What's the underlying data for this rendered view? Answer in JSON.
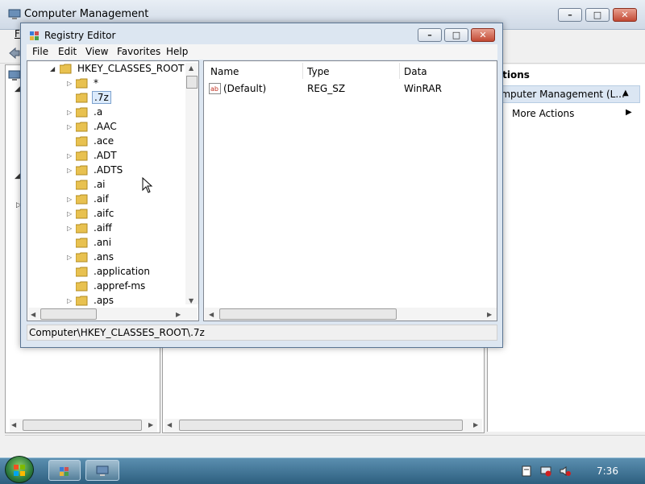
{
  "computer_management": {
    "title": "Computer Management",
    "menu_file": "F",
    "actions": {
      "header": "ctions",
      "selected_item": "omputer Management (L...",
      "more_actions": "More Actions"
    }
  },
  "registry_editor": {
    "title": "Registry Editor",
    "menu": [
      "File",
      "Edit",
      "View",
      "Favorites",
      "Help"
    ],
    "tree": {
      "root": "HKEY_CLASSES_ROOT",
      "items": [
        {
          "label": "*",
          "expandable": true,
          "selected": false
        },
        {
          "label": ".7z",
          "expandable": false,
          "selected": true
        },
        {
          "label": ".a",
          "expandable": true,
          "selected": false
        },
        {
          "label": ".AAC",
          "expandable": true,
          "selected": false
        },
        {
          "label": ".ace",
          "expandable": false,
          "selected": false
        },
        {
          "label": ".ADT",
          "expandable": true,
          "selected": false
        },
        {
          "label": ".ADTS",
          "expandable": true,
          "selected": false
        },
        {
          "label": ".ai",
          "expandable": false,
          "selected": false
        },
        {
          "label": ".aif",
          "expandable": true,
          "selected": false
        },
        {
          "label": ".aifc",
          "expandable": true,
          "selected": false
        },
        {
          "label": ".aiff",
          "expandable": true,
          "selected": false
        },
        {
          "label": ".ani",
          "expandable": false,
          "selected": false
        },
        {
          "label": ".ans",
          "expandable": true,
          "selected": false
        },
        {
          "label": ".application",
          "expandable": false,
          "selected": false
        },
        {
          "label": ".appref-ms",
          "expandable": false,
          "selected": false
        },
        {
          "label": ".aps",
          "expandable": true,
          "selected": false
        }
      ]
    },
    "list": {
      "columns": [
        "Name",
        "Type",
        "Data"
      ],
      "rows": [
        {
          "name": "(Default)",
          "type": "REG_SZ",
          "data": "WinRAR"
        }
      ]
    },
    "status_path": "Computer\\HKEY_CLASSES_ROOT\\.7z"
  },
  "taskbar": {
    "clock": "7:36"
  },
  "colors": {
    "selection_bg": "#dcebfc",
    "selection_border": "#7da2ce",
    "close_button": "#c24a34"
  }
}
